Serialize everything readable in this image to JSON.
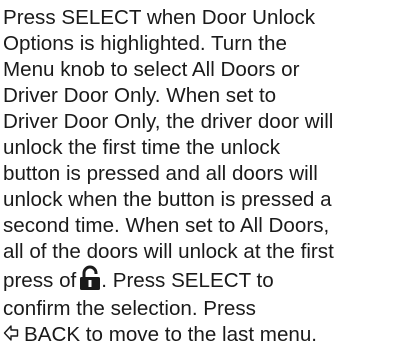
{
  "document": {
    "lines": [
      "Press SELECT when Door Unlock",
      "Options is highlighted. Turn the",
      "Menu knob to select All Doors or",
      "Driver Door Only. When set to",
      "Driver Door Only, the driver door will",
      "unlock the first time the unlock",
      "button is pressed and all doors will",
      "unlock when the button is pressed a",
      "second time. When set to All Doors,",
      "all of the doors will unlock at the first"
    ],
    "lock_line": {
      "before": "press of",
      "icon": "unlock-icon",
      "after": ". Press SELECT to"
    },
    "confirm_line": "confirm the selection. Press",
    "back_line": {
      "icon": "back-arrow-icon",
      "text": "BACK to move to the last menu."
    }
  }
}
